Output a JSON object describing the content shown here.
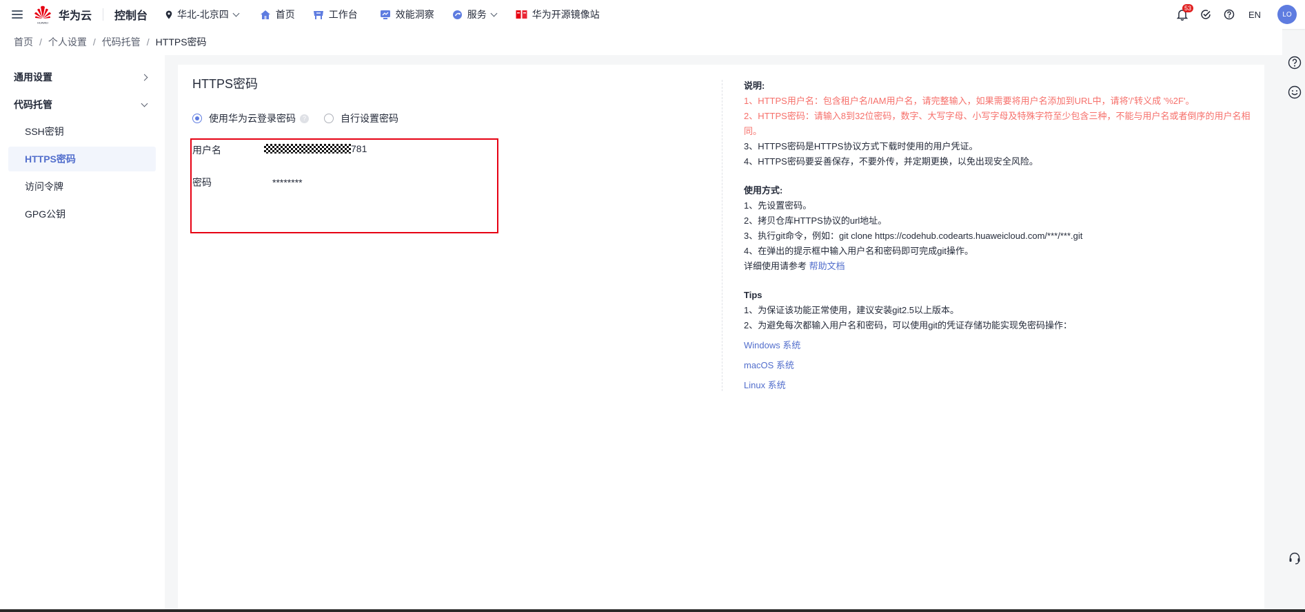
{
  "brand": {
    "name": "华为云",
    "logo_sub": "HUAWEI",
    "console": "控制台"
  },
  "nav": {
    "region": "华北-北京四",
    "items": [
      {
        "label": "首页",
        "icon": "home-icon"
      },
      {
        "label": "工作台",
        "icon": "workbench-icon"
      },
      {
        "label": "效能洞察",
        "icon": "insight-icon"
      },
      {
        "label": "服务",
        "icon": "service-icon"
      },
      {
        "label": "华为开源镜像站",
        "icon": "mirror-icon"
      }
    ]
  },
  "topright": {
    "notification_count": "53",
    "lang": "EN",
    "avatar": "LO"
  },
  "breadcrumb": [
    "首页",
    "个人设置",
    "代码托管",
    "HTTPS密码"
  ],
  "sidebar": {
    "groups": [
      {
        "label": "通用设置"
      },
      {
        "label": "代码托管"
      }
    ],
    "items": [
      {
        "label": "SSH密钥"
      },
      {
        "label": "HTTPS密码"
      },
      {
        "label": "访问令牌"
      },
      {
        "label": "GPG公钥"
      }
    ]
  },
  "main": {
    "title": "HTTPS密码",
    "radio_options": [
      "使用华为云登录密码",
      "自行设置密码"
    ],
    "hint_mark": "?",
    "fields": {
      "username_label": "用户名",
      "username_suffix": "781",
      "password_label": "密码",
      "password_value": "********"
    }
  },
  "info": {
    "desc_title": "说明:",
    "desc": [
      "1、HTTPS用户名：包含租户名/IAM用户名，请完整输入，如果需要将用户名添加到URL中，请将'/'转义成 '%2F'。",
      "2、HTTPS密码：请输入8到32位密码，数字、大写字母、小写字母及特殊字符至少包含三种，不能与用户名或者倒序的用户名相同。",
      "3、HTTPS密码是HTTPS协议方式下载时使用的用户凭证。",
      "4、HTTPS密码要妥善保存，不要外传，并定期更换，以免出现安全风险。"
    ],
    "usage_title": "使用方式:",
    "usage": [
      "1、先设置密码。",
      "2、拷贝仓库HTTPS协议的url地址。",
      "3、执行git命令，例如：git clone https://codehub.codearts.huaweicloud.com/***/***.git",
      "4、在弹出的提示框中输入用户名和密码即可完成git操作。"
    ],
    "detail_prefix": "详细使用请参考",
    "detail_link": "帮助文档",
    "tips_title": "Tips",
    "tips": [
      "1、为保证该功能正常使用，建议安装git2.5以上版本。",
      "2、为避免每次都输入用户名和密码，可以使用git的凭证存储功能实现免密码操作："
    ],
    "os_links": [
      "Windows 系统",
      "macOS 系统",
      "Linux 系统"
    ]
  },
  "colors": {
    "accent": "#5e7ce0",
    "link": "#526ecc",
    "warning_text": "#f66f6a",
    "highlight_border": "#e60012"
  }
}
